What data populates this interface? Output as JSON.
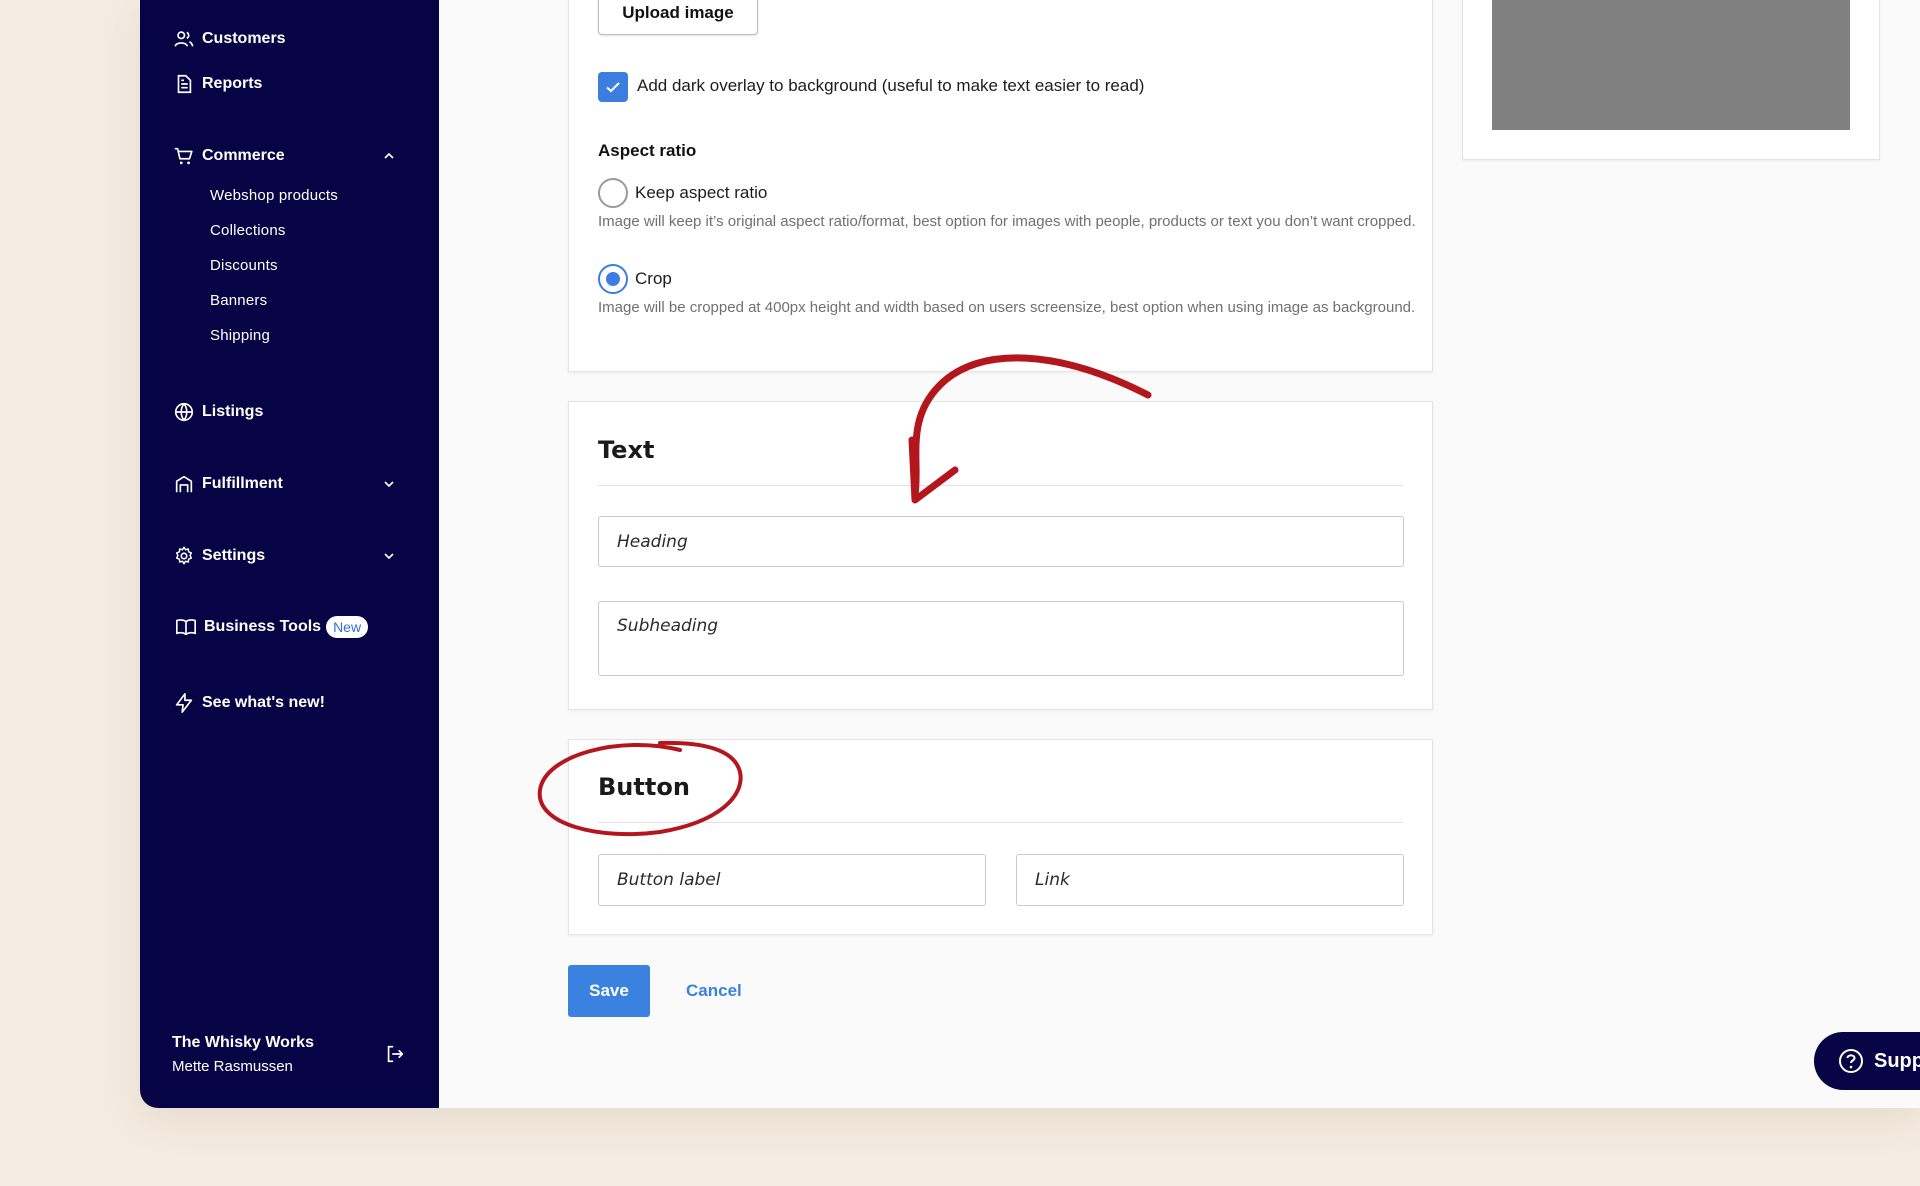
{
  "sidebar": {
    "items": [
      {
        "label": "Customers",
        "icon": "users-icon"
      },
      {
        "label": "Reports",
        "icon": "document-icon"
      },
      {
        "label": "Commerce",
        "icon": "cart-icon"
      },
      {
        "label": "Listings",
        "icon": "globe-icon"
      },
      {
        "label": "Fulfillment",
        "icon": "store-icon"
      },
      {
        "label": "Settings",
        "icon": "gear-icon"
      },
      {
        "label": "Business Tools",
        "icon": "book-icon",
        "badge": "New"
      },
      {
        "label": "See what's new!",
        "icon": "lightning-icon"
      }
    ],
    "commerce_sub": [
      "Webshop products",
      "Collections",
      "Discounts",
      "Banners",
      "Shipping"
    ],
    "shop_name": "The Whisky Works",
    "user_name": "Mette Rasmussen"
  },
  "image_section": {
    "upload_label": "Upload image",
    "overlay_checked": true,
    "overlay_label": "Add dark overlay to background (useful to make text easier to read)",
    "aspect_title": "Aspect ratio",
    "options": [
      {
        "label": "Keep aspect ratio",
        "help": "Image will keep it’s original aspect ratio/format, best option for images with people, products or text you don’t want cropped.",
        "selected": false
      },
      {
        "label": "Crop",
        "help": "Image will be cropped at 400px height and width based on users screensize, best option when using image as background.",
        "selected": true
      }
    ]
  },
  "text_section": {
    "title": "Text",
    "heading_placeholder": "Heading",
    "subheading_placeholder": "Subheading"
  },
  "button_section": {
    "title": "Button",
    "label_placeholder": "Button label",
    "link_placeholder": "Link"
  },
  "actions": {
    "save": "Save",
    "cancel": "Cancel"
  },
  "support": {
    "label": "Supp"
  },
  "colors": {
    "sidebar": "#060444",
    "accent": "#3b82e0",
    "annotation": "#b3161c"
  }
}
